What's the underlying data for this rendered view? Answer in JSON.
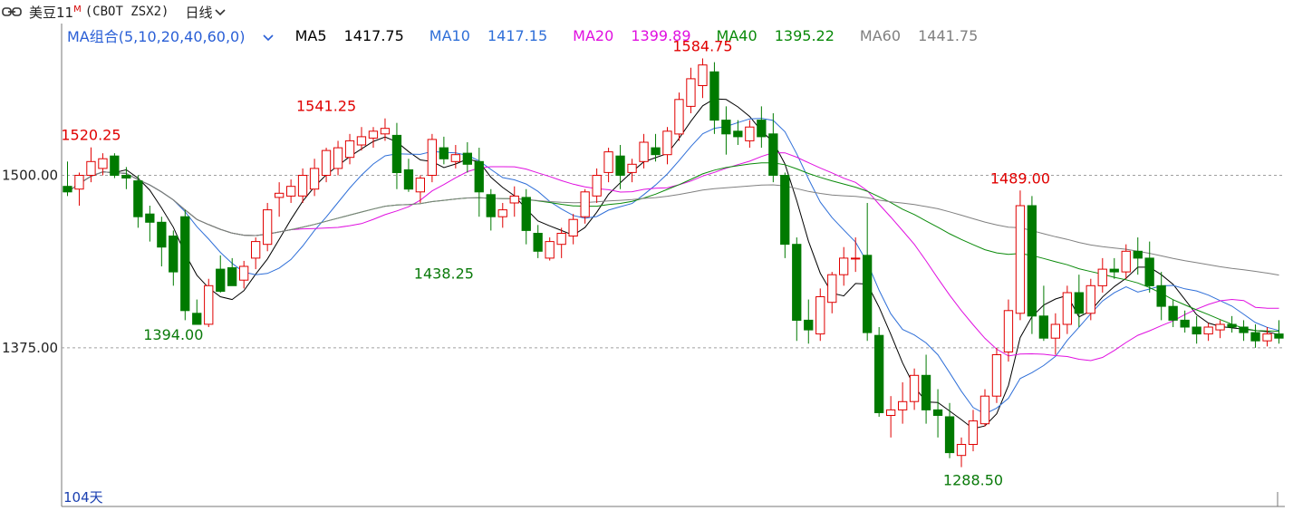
{
  "toolbar": {
    "title": "美豆11",
    "title_sup": "M",
    "code": "(CBOT ZSX2)",
    "period": "日线",
    "link_icon": "chain-link-icon",
    "period_icon": "chevron-down-icon"
  },
  "ma_legend": {
    "combo_label": "MA组合(5,10,20,40,60,0)",
    "combo_icon": "chevron-down-icon",
    "items": [
      {
        "label": "MA5",
        "value": "1417.75",
        "color": "#000000"
      },
      {
        "label": "MA10",
        "value": "1417.15",
        "color": "#2f6fd8"
      },
      {
        "label": "MA20",
        "value": "1399.89",
        "color": "#e010e0"
      },
      {
        "label": "MA40",
        "value": "1395.22",
        "color": "#0a8a0a"
      },
      {
        "label": "MA60",
        "value": "1441.75",
        "color": "#808080"
      }
    ]
  },
  "bars_label": "104天",
  "colors": {
    "up": "#e00000",
    "down": "#007a00",
    "down_fill": "#007a00",
    "grid": "#a0a0a0",
    "axis": "#555555"
  },
  "chart_data": {
    "type": "candlestick",
    "y_ticks": [
      {
        "value": 1500,
        "label": "1500.00"
      },
      {
        "value": 1375,
        "label": "1375.00"
      }
    ],
    "ylim": [
      1260,
      1610
    ],
    "bar_count": 104,
    "annotations": [
      {
        "label": "1520.25",
        "bar": 2,
        "price": 1520.25,
        "kind": "high"
      },
      {
        "label": "1394.00",
        "bar": 9,
        "price": 1394.0,
        "kind": "low"
      },
      {
        "label": "1541.25",
        "bar": 22,
        "price": 1541.25,
        "kind": "high"
      },
      {
        "label": "1438.25",
        "bar": 32,
        "price": 1438.25,
        "kind": "low"
      },
      {
        "label": "1584.75",
        "bar": 54,
        "price": 1584.75,
        "kind": "high"
      },
      {
        "label": "1489.00",
        "bar": 81,
        "price": 1489.0,
        "kind": "high"
      },
      {
        "label": "1288.50",
        "bar": 77,
        "price": 1288.5,
        "kind": "low"
      }
    ],
    "candles": [
      [
        1492,
        1510,
        1485,
        1488
      ],
      [
        1490,
        1502,
        1478,
        1500
      ],
      [
        1500,
        1520.25,
        1495,
        1510
      ],
      [
        1505,
        1516,
        1500,
        1512
      ],
      [
        1514,
        1516,
        1498,
        1500
      ],
      [
        1500,
        1506,
        1490,
        1498
      ],
      [
        1496,
        1500,
        1462,
        1470
      ],
      [
        1472,
        1478,
        1452,
        1466
      ],
      [
        1466,
        1470,
        1434,
        1448
      ],
      [
        1456,
        1460,
        1420,
        1430
      ],
      [
        1470,
        1475,
        1395,
        1402
      ],
      [
        1400,
        1410,
        1394,
        1392
      ],
      [
        1392,
        1425,
        1390,
        1420
      ],
      [
        1432,
        1442,
        1415,
        1416
      ],
      [
        1433,
        1440,
        1420,
        1420
      ],
      [
        1424,
        1438,
        1418,
        1434
      ],
      [
        1440,
        1455,
        1432,
        1452
      ],
      [
        1450,
        1480,
        1445,
        1475
      ],
      [
        1484,
        1495,
        1470,
        1487
      ],
      [
        1485,
        1497,
        1480,
        1492
      ],
      [
        1485,
        1505,
        1480,
        1500
      ],
      [
        1490,
        1512,
        1485,
        1505
      ],
      [
        1500,
        1520,
        1495,
        1518
      ],
      [
        1505,
        1525,
        1500,
        1520
      ],
      [
        1513,
        1530,
        1508,
        1525
      ],
      [
        1522,
        1535,
        1518,
        1528
      ],
      [
        1527,
        1535,
        1520,
        1532
      ],
      [
        1530,
        1541.25,
        1525,
        1534
      ],
      [
        1529,
        1538,
        1490,
        1502
      ],
      [
        1504,
        1512,
        1488,
        1490
      ],
      [
        1488,
        1500,
        1480,
        1498
      ],
      [
        1500,
        1530,
        1495,
        1526
      ],
      [
        1520,
        1528,
        1508,
        1512
      ],
      [
        1510,
        1522,
        1505,
        1515
      ],
      [
        1516,
        1524,
        1502,
        1508
      ],
      [
        1510,
        1520,
        1470,
        1488
      ],
      [
        1486,
        1490,
        1460,
        1470
      ],
      [
        1470,
        1480,
        1462,
        1475
      ],
      [
        1480,
        1492,
        1470,
        1485
      ],
      [
        1484,
        1490,
        1450,
        1460
      ],
      [
        1458,
        1464,
        1440,
        1445
      ],
      [
        1440,
        1455,
        1438.25,
        1452
      ],
      [
        1450,
        1462,
        1440,
        1458
      ],
      [
        1456,
        1472,
        1450,
        1468
      ],
      [
        1470,
        1490,
        1465,
        1488
      ],
      [
        1485,
        1505,
        1480,
        1500
      ],
      [
        1502,
        1520,
        1495,
        1517
      ],
      [
        1514,
        1522,
        1490,
        1500
      ],
      [
        1502,
        1512,
        1495,
        1508
      ],
      [
        1510,
        1530,
        1505,
        1524
      ],
      [
        1520,
        1530,
        1510,
        1515
      ],
      [
        1515,
        1535,
        1508,
        1532
      ],
      [
        1530,
        1560,
        1525,
        1555
      ],
      [
        1550,
        1578,
        1545,
        1570
      ],
      [
        1565,
        1584.75,
        1556,
        1580
      ],
      [
        1575,
        1582,
        1530,
        1540
      ],
      [
        1540,
        1550,
        1515,
        1530
      ],
      [
        1532,
        1540,
        1522,
        1528
      ],
      [
        1525,
        1540,
        1520,
        1535
      ],
      [
        1540,
        1550,
        1520,
        1528
      ],
      [
        1530,
        1545,
        1495,
        1500
      ],
      [
        1500,
        1502,
        1440,
        1450
      ],
      [
        1450,
        1455,
        1380,
        1395
      ],
      [
        1395,
        1410,
        1378,
        1388
      ],
      [
        1385,
        1418,
        1380,
        1412
      ],
      [
        1408,
        1430,
        1400,
        1428
      ],
      [
        1428,
        1448,
        1420,
        1440
      ],
      [
        1440,
        1455,
        1430,
        1440
      ],
      [
        1442,
        1480,
        1380,
        1386
      ],
      [
        1384,
        1390,
        1325,
        1328
      ],
      [
        1326,
        1340,
        1310,
        1330
      ],
      [
        1330,
        1350,
        1320,
        1336
      ],
      [
        1336,
        1360,
        1330,
        1355
      ],
      [
        1355,
        1370,
        1320,
        1330
      ],
      [
        1330,
        1345,
        1310,
        1326
      ],
      [
        1325,
        1335,
        1295,
        1299
      ],
      [
        1297,
        1310,
        1288.5,
        1305
      ],
      [
        1305,
        1330,
        1300,
        1322
      ],
      [
        1320,
        1345,
        1318,
        1340
      ],
      [
        1340,
        1375,
        1335,
        1370
      ],
      [
        1372,
        1410,
        1365,
        1402
      ],
      [
        1400,
        1489.0,
        1395,
        1478
      ],
      [
        1478,
        1485,
        1385,
        1398
      ],
      [
        1398,
        1420,
        1380,
        1382
      ],
      [
        1382,
        1400,
        1370,
        1392
      ],
      [
        1392,
        1420,
        1385,
        1415
      ],
      [
        1415,
        1428,
        1390,
        1400
      ],
      [
        1400,
        1425,
        1395,
        1420
      ],
      [
        1420,
        1440,
        1415,
        1432
      ],
      [
        1432,
        1440,
        1425,
        1430
      ],
      [
        1430,
        1450,
        1425,
        1445
      ],
      [
        1445,
        1455,
        1428,
        1440
      ],
      [
        1440,
        1452,
        1415,
        1420
      ],
      [
        1420,
        1430,
        1395,
        1405
      ],
      [
        1405,
        1410,
        1390,
        1395
      ],
      [
        1395,
        1402,
        1386,
        1390
      ],
      [
        1390,
        1398,
        1378,
        1385
      ],
      [
        1385,
        1393,
        1380,
        1390
      ],
      [
        1388,
        1395,
        1382,
        1392
      ],
      [
        1392,
        1398,
        1386,
        1390
      ],
      [
        1390,
        1395,
        1380,
        1386
      ],
      [
        1386,
        1392,
        1375,
        1380
      ],
      [
        1380,
        1390,
        1376,
        1385
      ],
      [
        1385,
        1395,
        1378,
        1382
      ]
    ]
  }
}
